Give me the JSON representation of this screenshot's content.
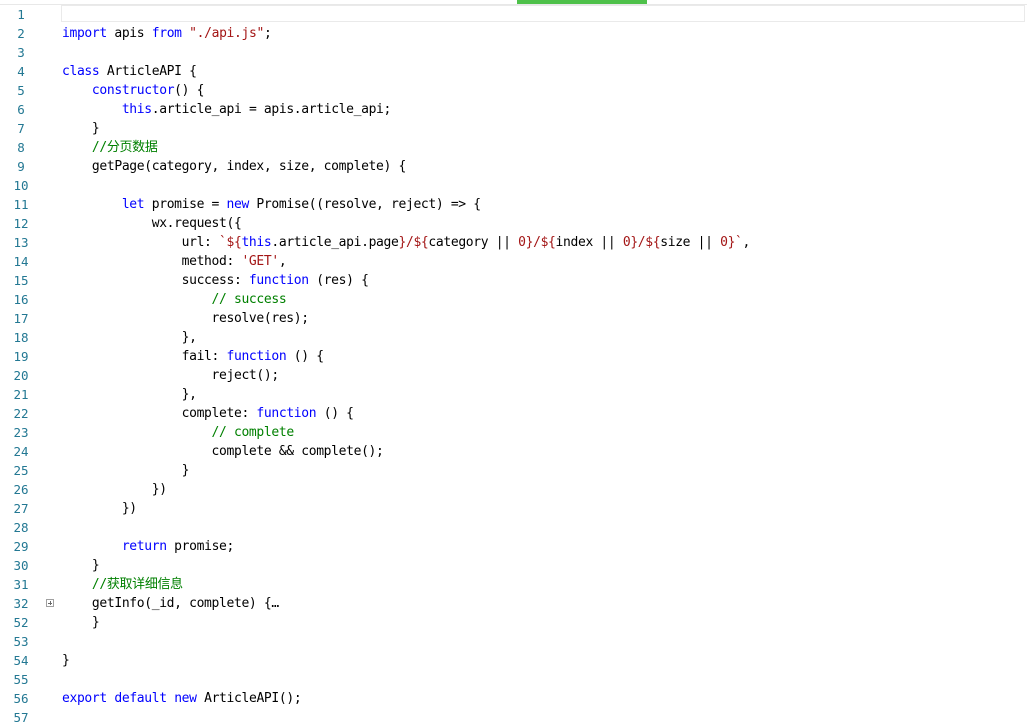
{
  "editor": {
    "lines": [
      {
        "n": "1",
        "tokens": []
      },
      {
        "n": "2",
        "tokens": [
          {
            "k": "k",
            "v": "import"
          },
          {
            "k": "t",
            "v": " apis "
          },
          {
            "k": "k",
            "v": "from"
          },
          {
            "k": "t",
            "v": " "
          },
          {
            "k": "s",
            "v": "\"./api.js\""
          },
          {
            "k": "t",
            "v": ";"
          }
        ]
      },
      {
        "n": "3",
        "tokens": []
      },
      {
        "n": "4",
        "tokens": [
          {
            "k": "k",
            "v": "class"
          },
          {
            "k": "t",
            "v": " ArticleAPI {"
          }
        ]
      },
      {
        "n": "5",
        "tokens": [
          {
            "k": "t",
            "v": "    "
          },
          {
            "k": "k",
            "v": "constructor"
          },
          {
            "k": "t",
            "v": "() {"
          }
        ]
      },
      {
        "n": "6",
        "tokens": [
          {
            "k": "t",
            "v": "        "
          },
          {
            "k": "k",
            "v": "this"
          },
          {
            "k": "t",
            "v": ".article_api = apis.article_api;"
          }
        ]
      },
      {
        "n": "7",
        "tokens": [
          {
            "k": "t",
            "v": "    }"
          }
        ]
      },
      {
        "n": "8",
        "tokens": [
          {
            "k": "t",
            "v": "    "
          },
          {
            "k": "c",
            "v": "//分页数据"
          }
        ]
      },
      {
        "n": "9",
        "tokens": [
          {
            "k": "t",
            "v": "    getPage(category, index, size, complete) {"
          }
        ]
      },
      {
        "n": "10",
        "tokens": []
      },
      {
        "n": "11",
        "tokens": [
          {
            "k": "t",
            "v": "        "
          },
          {
            "k": "k",
            "v": "let"
          },
          {
            "k": "t",
            "v": " promise = "
          },
          {
            "k": "k",
            "v": "new"
          },
          {
            "k": "t",
            "v": " Promise((resolve, reject) => {"
          }
        ]
      },
      {
        "n": "12",
        "tokens": [
          {
            "k": "t",
            "v": "            wx.request({"
          }
        ]
      },
      {
        "n": "13",
        "tokens": [
          {
            "k": "t",
            "v": "                url: "
          },
          {
            "k": "s",
            "v": "`${"
          },
          {
            "k": "k",
            "v": "this"
          },
          {
            "k": "t",
            "v": ".article_api.page"
          },
          {
            "k": "s",
            "v": "}/${"
          },
          {
            "k": "t",
            "v": "category || "
          },
          {
            "k": "s",
            "v": "0"
          },
          {
            "k": "s",
            "v": "}/${"
          },
          {
            "k": "t",
            "v": "index || "
          },
          {
            "k": "s",
            "v": "0"
          },
          {
            "k": "s",
            "v": "}/${"
          },
          {
            "k": "t",
            "v": "size || "
          },
          {
            "k": "s",
            "v": "0"
          },
          {
            "k": "s",
            "v": "}`"
          },
          {
            "k": "t",
            "v": ","
          }
        ]
      },
      {
        "n": "14",
        "tokens": [
          {
            "k": "t",
            "v": "                method: "
          },
          {
            "k": "s",
            "v": "'GET'"
          },
          {
            "k": "t",
            "v": ","
          }
        ]
      },
      {
        "n": "15",
        "tokens": [
          {
            "k": "t",
            "v": "                success: "
          },
          {
            "k": "k",
            "v": "function"
          },
          {
            "k": "t",
            "v": " (res) {"
          }
        ]
      },
      {
        "n": "16",
        "tokens": [
          {
            "k": "t",
            "v": "                    "
          },
          {
            "k": "c",
            "v": "// success"
          }
        ]
      },
      {
        "n": "17",
        "tokens": [
          {
            "k": "t",
            "v": "                    resolve(res);"
          }
        ]
      },
      {
        "n": "18",
        "tokens": [
          {
            "k": "t",
            "v": "                },"
          }
        ]
      },
      {
        "n": "19",
        "tokens": [
          {
            "k": "t",
            "v": "                fail: "
          },
          {
            "k": "k",
            "v": "function"
          },
          {
            "k": "t",
            "v": " () {"
          }
        ]
      },
      {
        "n": "20",
        "tokens": [
          {
            "k": "t",
            "v": "                    reject();"
          }
        ]
      },
      {
        "n": "21",
        "tokens": [
          {
            "k": "t",
            "v": "                },"
          }
        ]
      },
      {
        "n": "22",
        "tokens": [
          {
            "k": "t",
            "v": "                complete: "
          },
          {
            "k": "k",
            "v": "function"
          },
          {
            "k": "t",
            "v": " () {"
          }
        ]
      },
      {
        "n": "23",
        "tokens": [
          {
            "k": "t",
            "v": "                    "
          },
          {
            "k": "c",
            "v": "// complete"
          }
        ]
      },
      {
        "n": "24",
        "tokens": [
          {
            "k": "t",
            "v": "                    complete && complete();"
          }
        ]
      },
      {
        "n": "25",
        "tokens": [
          {
            "k": "t",
            "v": "                }"
          }
        ]
      },
      {
        "n": "26",
        "tokens": [
          {
            "k": "t",
            "v": "            })"
          }
        ]
      },
      {
        "n": "27",
        "tokens": [
          {
            "k": "t",
            "v": "        })"
          }
        ]
      },
      {
        "n": "28",
        "tokens": []
      },
      {
        "n": "29",
        "tokens": [
          {
            "k": "t",
            "v": "        "
          },
          {
            "k": "k",
            "v": "return"
          },
          {
            "k": "t",
            "v": " promise;"
          }
        ]
      },
      {
        "n": "30",
        "tokens": [
          {
            "k": "t",
            "v": "    }"
          }
        ]
      },
      {
        "n": "31",
        "tokens": [
          {
            "k": "t",
            "v": "    "
          },
          {
            "k": "c",
            "v": "//获取详细信息"
          }
        ]
      },
      {
        "n": "32",
        "fold": true,
        "tokens": [
          {
            "k": "t",
            "v": "    getInfo(_id, complete) {"
          },
          {
            "k": "t",
            "v": "…"
          }
        ]
      },
      {
        "n": "52",
        "tokens": [
          {
            "k": "t",
            "v": "    }"
          }
        ]
      },
      {
        "n": "53",
        "tokens": []
      },
      {
        "n": "54",
        "tokens": [
          {
            "k": "t",
            "v": "}"
          }
        ]
      },
      {
        "n": "55",
        "tokens": []
      },
      {
        "n": "56",
        "tokens": [
          {
            "k": "k",
            "v": "export"
          },
          {
            "k": "t",
            "v": " "
          },
          {
            "k": "k",
            "v": "default"
          },
          {
            "k": "t",
            "v": " "
          },
          {
            "k": "k",
            "v": "new"
          },
          {
            "k": "t",
            "v": " ArticleAPI();"
          }
        ]
      },
      {
        "n": "57",
        "tokens": []
      }
    ]
  },
  "colors": {
    "keyword": "#0000ff",
    "string": "#a31515",
    "comment": "#008000",
    "line_number": "#237893",
    "accent": "#4ec14a"
  }
}
